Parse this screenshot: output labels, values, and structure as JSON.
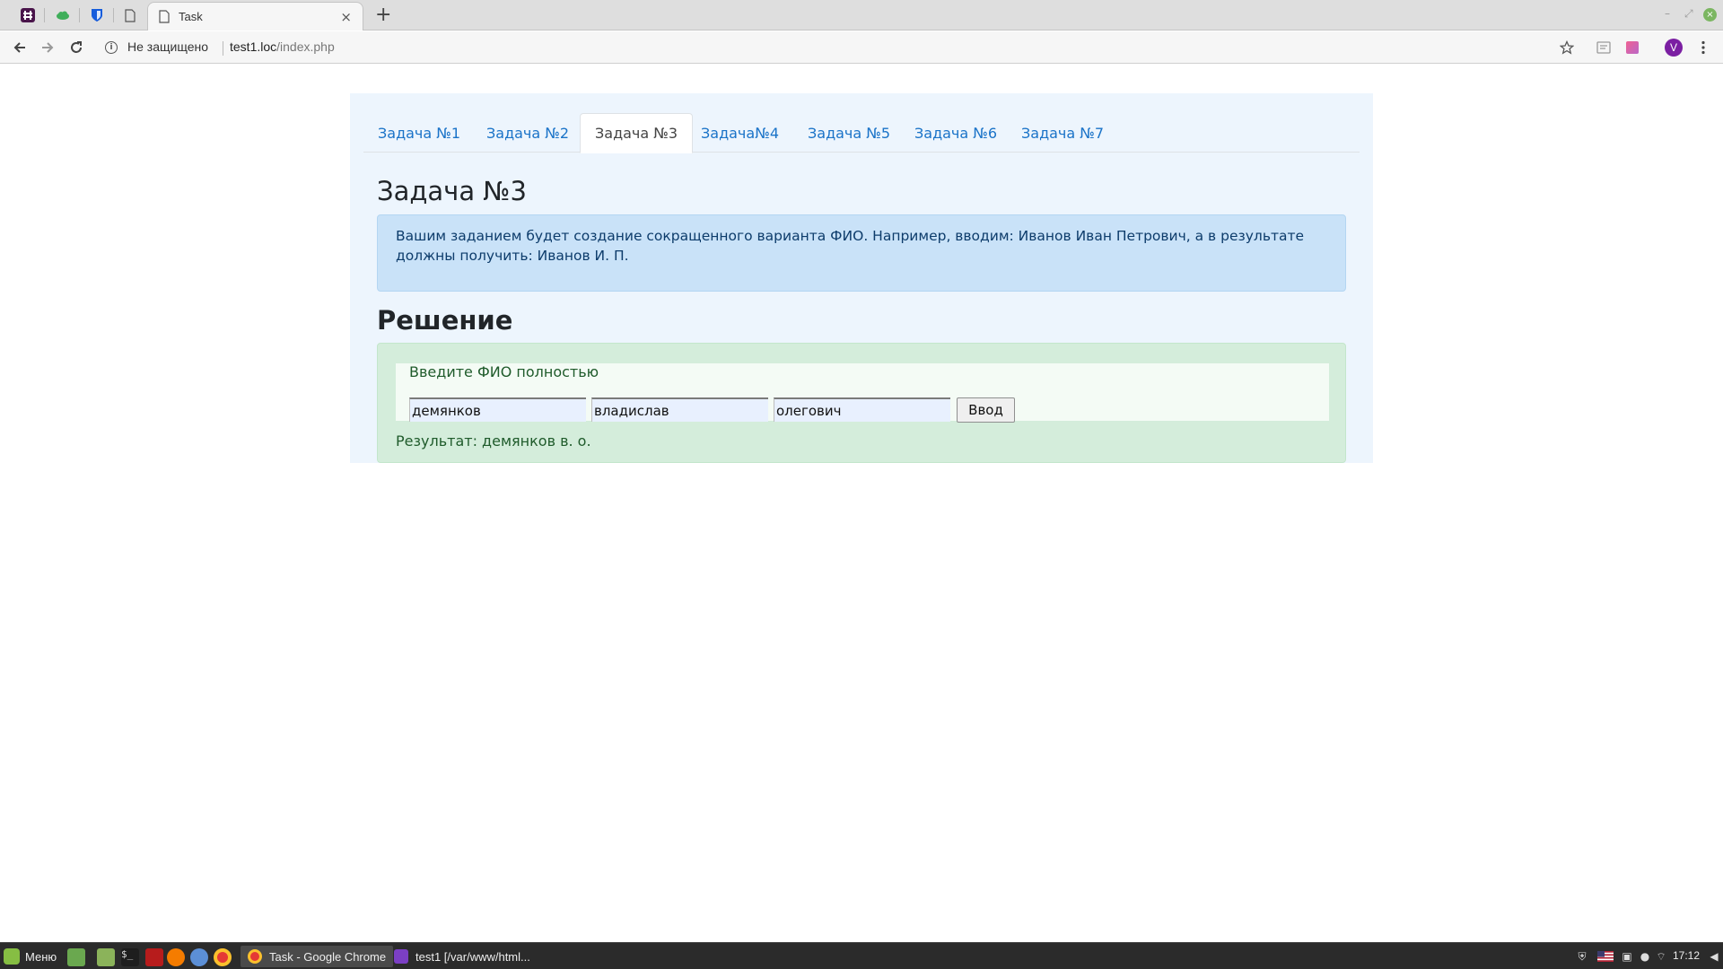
{
  "browser": {
    "tab_title": "Task",
    "tab_close": "×",
    "new_tab": "+",
    "security_text": "Не защищено",
    "url_host": "test1.loc",
    "url_path": "/index.php",
    "profile_initial": "V",
    "pinned_tabs": [
      "slack-icon",
      "cloud-icon",
      "bitwarden-icon",
      "document-icon"
    ]
  },
  "page": {
    "nav_tabs": [
      {
        "label": "Задача №1"
      },
      {
        "label": "Задача №2"
      },
      {
        "label": "Задача №3",
        "active": true
      },
      {
        "label": "Задача№4"
      },
      {
        "label": "Задача №5"
      },
      {
        "label": "Задача №6"
      },
      {
        "label": "Задача №7"
      }
    ],
    "task_title": "Задача №3",
    "task_description": "Вашим заданием будет создание сокращенного варианта ФИО. Например, вводим: Иванов Иван Петрович, а в результате должны получить: Иванов И. П.",
    "solution_title": "Решение",
    "form": {
      "label": "Введите ФИО полностью",
      "surname": "демянков",
      "name": "владислав",
      "patronymic": "олегович",
      "submit_label": "Ввод"
    },
    "result_text": "Результат: демянков в. о."
  },
  "taskbar": {
    "menu_label": "Меню",
    "items": [
      {
        "label": "Task - Google Chrome",
        "active": true
      },
      {
        "label": "test1 [/var/www/html..."
      }
    ],
    "clock": "17:12"
  },
  "colors": {
    "link": "#1a73c8",
    "container_bg": "#edf5fd",
    "info_bg": "#c9e2f8",
    "success_bg": "#d4eddb"
  }
}
